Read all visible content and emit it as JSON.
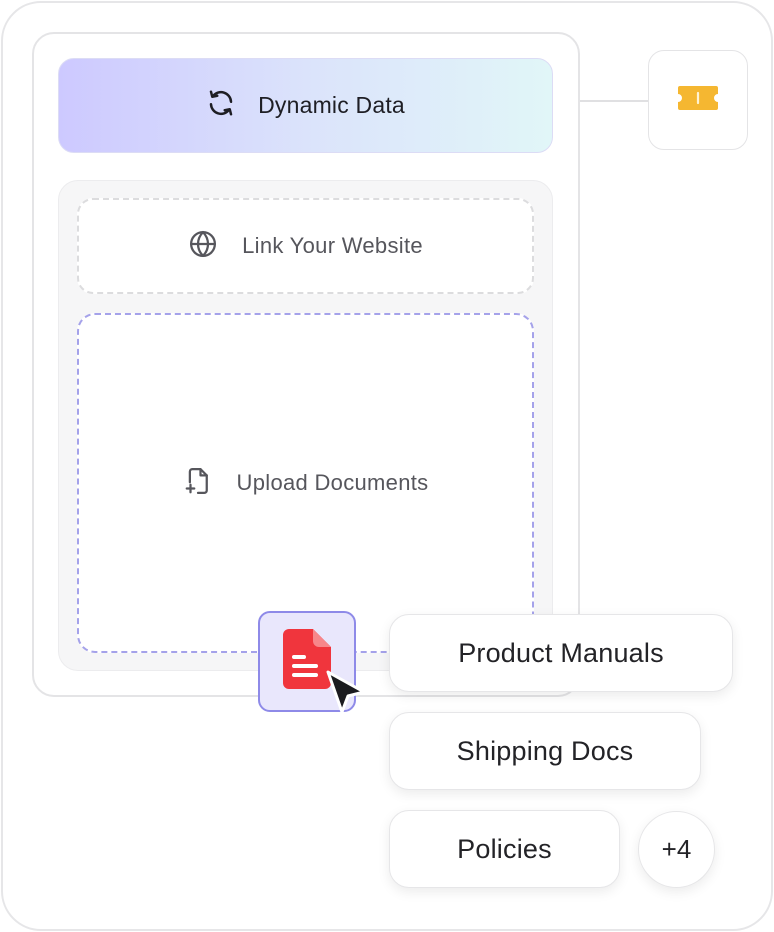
{
  "header": {
    "title": "Dynamic Data",
    "icon": "refresh-icon"
  },
  "sources": {
    "link_website": {
      "label": "Link Your Website",
      "icon": "globe-icon"
    },
    "upload_documents": {
      "label": "Upload Documents",
      "icon": "file-plus-icon"
    }
  },
  "integration": {
    "icon": "ticket-icon",
    "accent": "#f5b731"
  },
  "dragged_file": {
    "icon": "document-icon",
    "accent": "#f0353d",
    "cursor": "pointer-cursor-icon"
  },
  "document_tags": [
    {
      "label": "Product Manuals"
    },
    {
      "label": "Shipping Docs"
    },
    {
      "label": "Policies"
    }
  ],
  "more_tags": "+4",
  "colors": {
    "dashed_upload_border": "#a5a2ea",
    "header_gradient_start": "#cdc9ff",
    "header_gradient_end": "#e1f6f8"
  }
}
